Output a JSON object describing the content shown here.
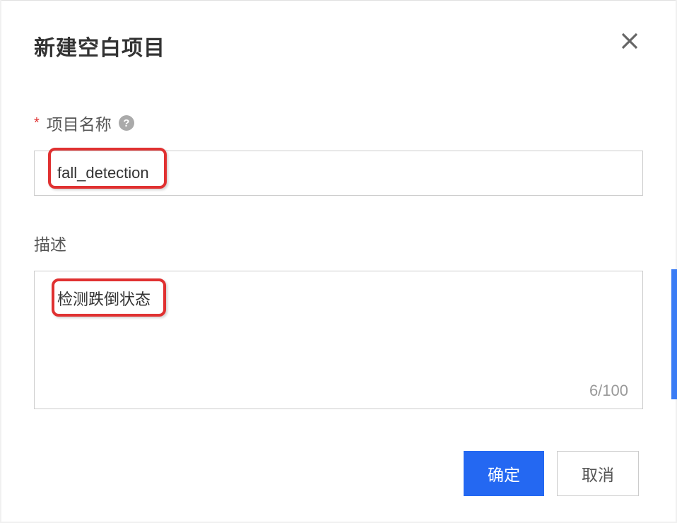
{
  "modal": {
    "title": "新建空白项目",
    "closeName": "close-icon"
  },
  "form": {
    "projectName": {
      "label": "项目名称",
      "required": "*",
      "value": "fall_detection"
    },
    "description": {
      "label": "描述",
      "value": "检测跌倒状态",
      "counter": "6/100"
    }
  },
  "footer": {
    "confirm": "确定",
    "cancel": "取消"
  }
}
